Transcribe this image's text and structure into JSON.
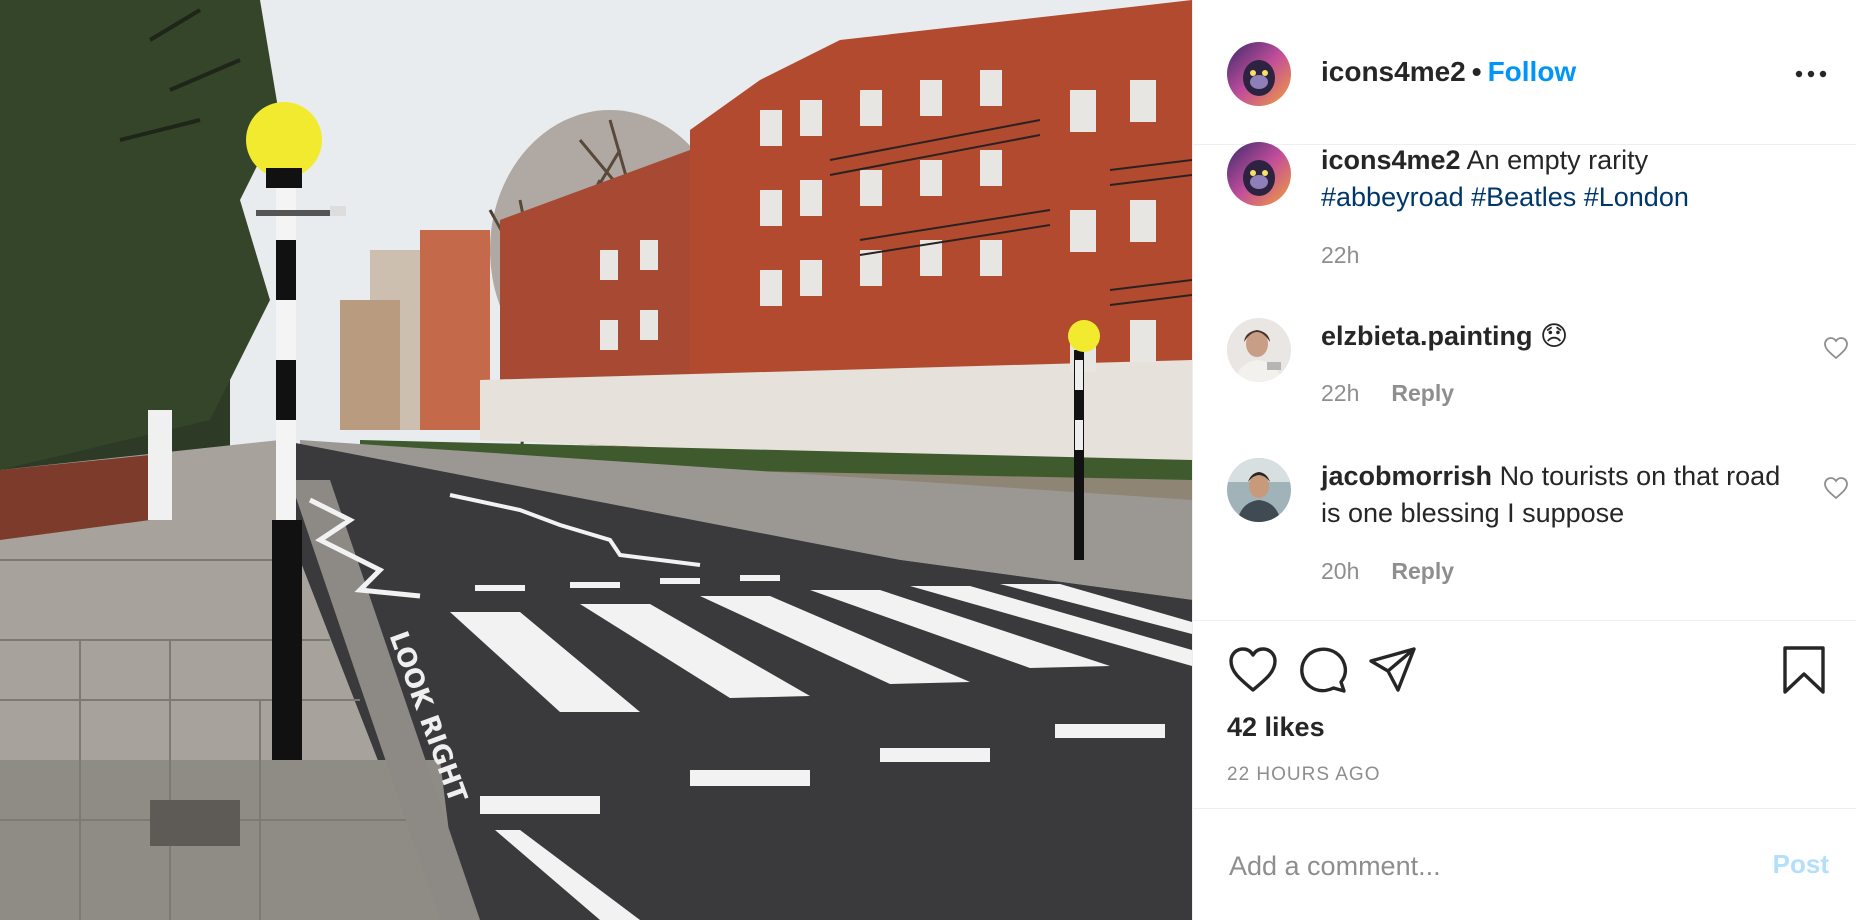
{
  "post": {
    "username": "icons4me2",
    "follow_label": "Follow",
    "separator": "•",
    "more_icon": "more-horizontal-icon"
  },
  "caption": {
    "username": "icons4me2",
    "text": "An empty rarity",
    "hashtags": [
      "#abbeyroad",
      "#Beatles",
      "#London"
    ],
    "time": "22h"
  },
  "comments": [
    {
      "username": "elzbieta.painting",
      "text": "😞",
      "time": "22h",
      "reply_label": "Reply"
    },
    {
      "username": "jacobmorrish",
      "text": "No tourists on that road is one blessing I suppose",
      "time": "20h",
      "reply_label": "Reply"
    }
  ],
  "actions": {
    "icons": [
      "heart-icon",
      "comment-icon",
      "share-icon",
      "bookmark-icon"
    ]
  },
  "likes_text": "42 likes",
  "time_ago": "22 HOURS AGO",
  "add_comment": {
    "placeholder": "Add a comment...",
    "post_label": "Post"
  },
  "colors": {
    "link_blue": "#0095f6",
    "hashtag_blue": "#00376b",
    "muted": "#8e8e8e",
    "post_disabled": "#b2dffc"
  }
}
